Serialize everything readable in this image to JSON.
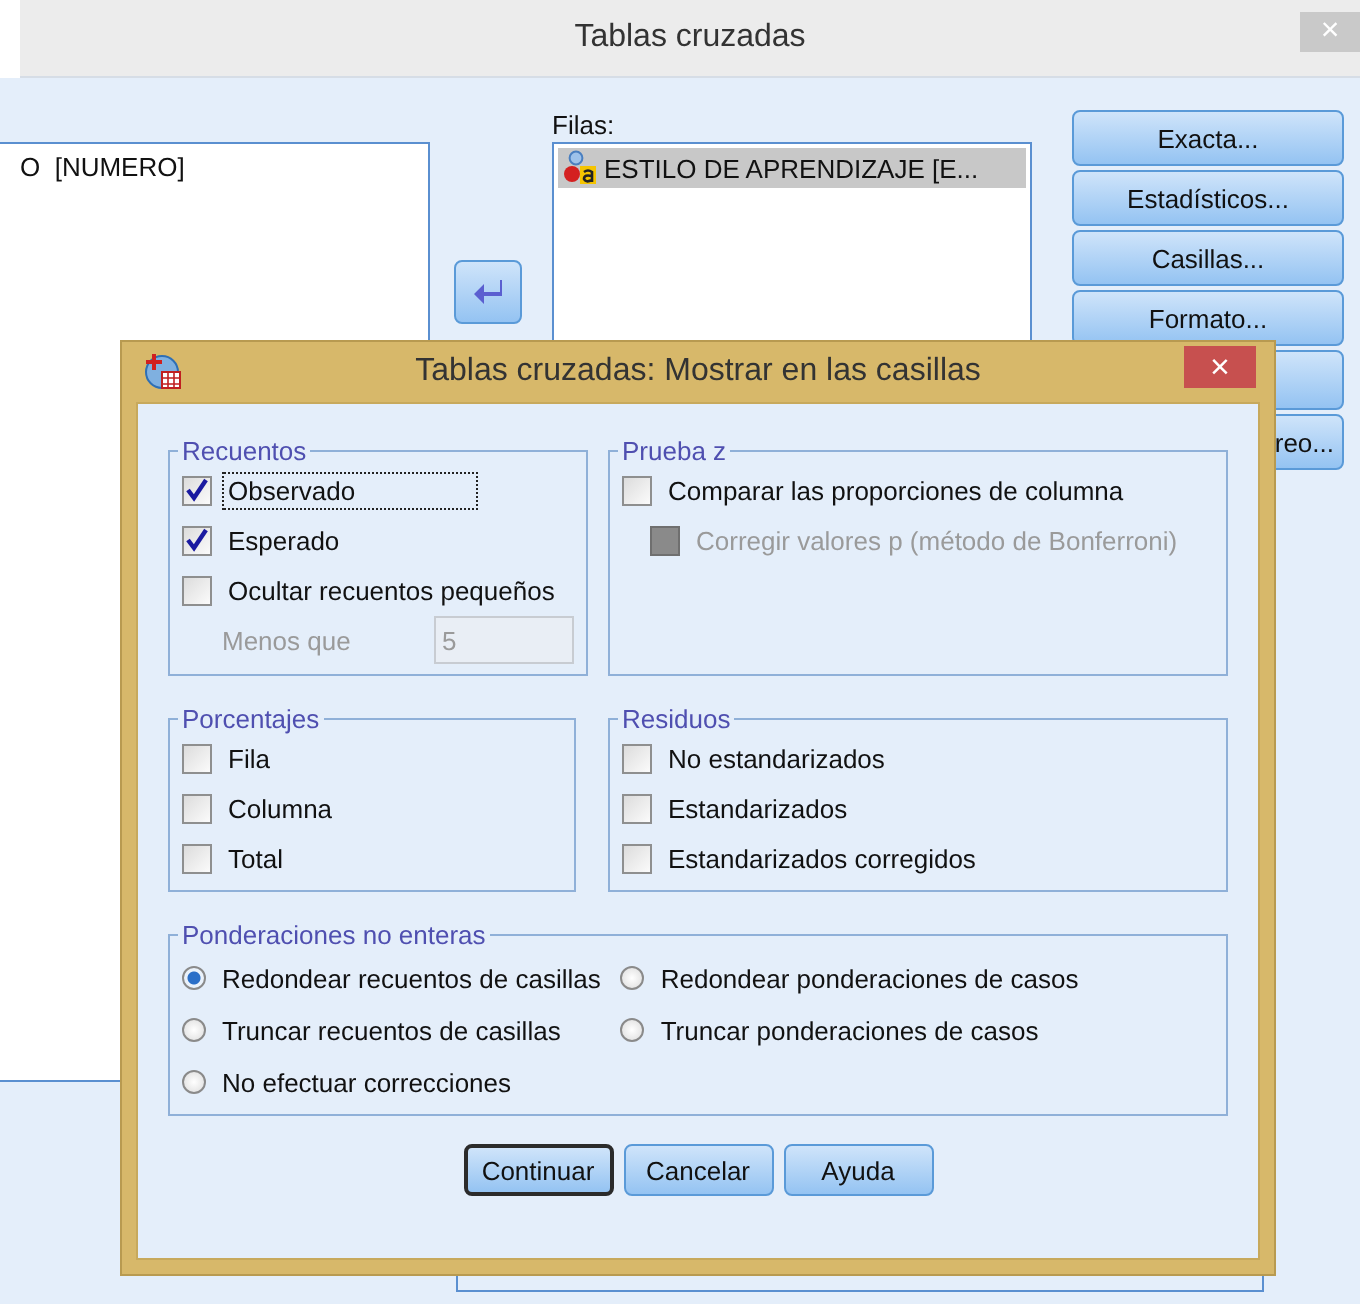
{
  "main_window": {
    "title": "Tablas cruzadas",
    "close": "×",
    "source_list": {
      "items": [
        "O  [NUMERO]"
      ]
    },
    "rows_list": {
      "label": "Filas:",
      "items": [
        {
          "text": "ESTILO DE APRENDIZAJE  [E...",
          "selected": true
        }
      ]
    },
    "buttons": [
      {
        "label": "Exacta..."
      },
      {
        "label": "Estadísticos..."
      },
      {
        "label": "Casillas..."
      },
      {
        "label": "Formato..."
      },
      {
        "label": "reo..."
      }
    ]
  },
  "dialog": {
    "title": "Tablas cruzadas: Mostrar en las casillas",
    "close": "×",
    "groups": [
      {
        "title": "Recuentos",
        "items": [
          {
            "kind": "checkbox",
            "label": "Observado",
            "checked": true,
            "focused": true,
            "disabled": false
          },
          {
            "kind": "checkbox",
            "label": "Esperado",
            "checked": true,
            "focused": false,
            "disabled": false
          },
          {
            "kind": "checkbox",
            "label": "Ocultar recuentos pequeños",
            "checked": false,
            "focused": false,
            "disabled": false
          },
          {
            "kind": "number_field",
            "label": "Menos que",
            "value": "5",
            "disabled": true
          }
        ]
      },
      {
        "title": "Prueba z",
        "items": [
          {
            "kind": "checkbox",
            "label": "Comparar las proporciones de columna",
            "checked": false,
            "focused": false,
            "disabled": false
          },
          {
            "kind": "sub_checkbox",
            "label": "Corregir valores p (método de Bonferroni)",
            "checked": false,
            "focused": false,
            "disabled": true
          }
        ]
      },
      {
        "title": "Porcentajes",
        "items": [
          {
            "kind": "checkbox",
            "label": "Fila",
            "checked": false,
            "focused": false,
            "disabled": false
          },
          {
            "kind": "checkbox",
            "label": "Columna",
            "checked": false,
            "focused": false,
            "disabled": false
          },
          {
            "kind": "checkbox",
            "label": "Total",
            "checked": false,
            "focused": false,
            "disabled": false
          }
        ]
      },
      {
        "title": "Residuos",
        "items": [
          {
            "kind": "checkbox",
            "label": "No estandarizados",
            "checked": false,
            "focused": false,
            "disabled": false
          },
          {
            "kind": "checkbox",
            "label": "Estandarizados",
            "checked": false,
            "focused": false,
            "disabled": false
          },
          {
            "kind": "checkbox",
            "label": "Estandarizados corregidos",
            "checked": false,
            "focused": false,
            "disabled": false
          }
        ]
      },
      {
        "title": "Ponderaciones no enteras",
        "items": [
          {
            "kind": "radio",
            "label": "Redondear recuentos de casillas",
            "selected": true
          },
          {
            "kind": "radio",
            "label": "Redondear ponderaciones de casos",
            "selected": false
          },
          {
            "kind": "radio",
            "label": "Truncar recuentos de casillas",
            "selected": false
          },
          {
            "kind": "radio",
            "label": "Truncar ponderaciones de casos",
            "selected": false
          },
          {
            "kind": "radio",
            "label": "No efectuar correcciones",
            "selected": false
          }
        ]
      }
    ],
    "buttons": [
      {
        "label": "Continuar",
        "default": true
      },
      {
        "label": "Cancelar",
        "default": false
      },
      {
        "label": "Ayuda",
        "default": false
      }
    ]
  }
}
